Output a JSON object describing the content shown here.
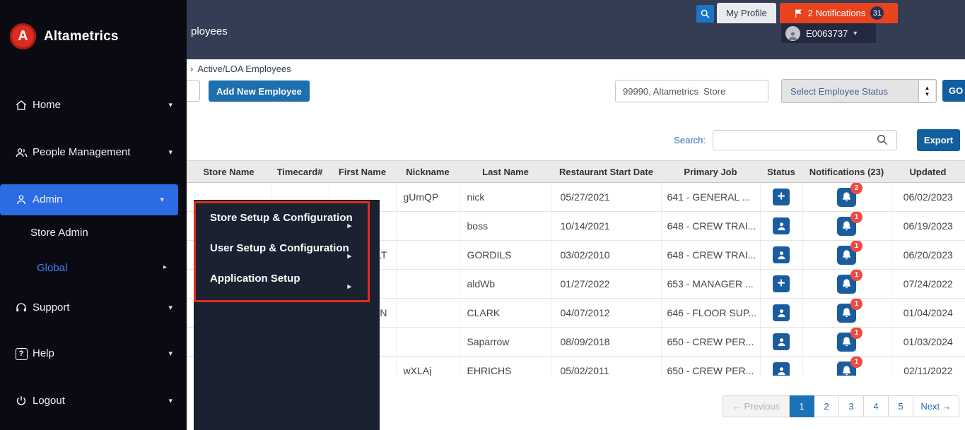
{
  "icons": {
    "chevron_down": "▾",
    "chevron_right": "▸",
    "breadcrumb_arrow": "›",
    "caret_down": "▾",
    "spinner_up": "▲",
    "spinner_down": "▼",
    "plus": "+",
    "help_mark": "?"
  },
  "colors": {
    "accent_blue": "#1b5c9e",
    "notification_red": "#e8431f",
    "annotation_red": "#e52b1e",
    "admin_highlight": "#2b6be4"
  },
  "sidebar": {
    "brand": "Altametrics",
    "brand_initial": "A",
    "items": [
      {
        "label": "Home"
      },
      {
        "label": "People Management"
      },
      {
        "label": "Admin"
      },
      {
        "label": "Store Admin"
      },
      {
        "label": "Global"
      },
      {
        "label": "Support"
      },
      {
        "label": "Help"
      },
      {
        "label": "Logout"
      }
    ]
  },
  "topbar": {
    "page_title_fragment": "ployees",
    "my_profile_label": "My Profile",
    "notifications_label": "2 Notifications",
    "notifications_badge": "31",
    "user_id": "E0063737"
  },
  "breadcrumb": {
    "label": "Active/LOA Employees"
  },
  "toolbar": {
    "add_employee_label": "Add New Employee",
    "store_value": "99990, Altametrics  Store",
    "employee_status_value": "Select Employee Status",
    "go_label": "GO"
  },
  "search_bar": {
    "label": "Search:",
    "value": "",
    "export_label": "Export"
  },
  "admin_flyout": {
    "items": [
      {
        "label": "Store Setup & Configuration"
      },
      {
        "label": "User Setup & Configuration"
      },
      {
        "label": "Application Setup"
      }
    ]
  },
  "table": {
    "headers": [
      "Store Name",
      "Timecard#",
      "First Name",
      "Nickname",
      "Last Name",
      "Restaurant Start Date",
      "Primary Job",
      "Status",
      "Notifications (23)",
      "Updated"
    ],
    "rows": [
      {
        "store_name": "",
        "timecard": "",
        "first_name": "",
        "nickname": "gUmQP",
        "last_name": "nick",
        "start_date": "05/27/2021",
        "primary_job": "641 - GENERAL ...",
        "status_icon": "plus",
        "notification_count": "2",
        "updated": "06/02/2023"
      },
      {
        "store_name": "",
        "timecard": "",
        "first_name": "",
        "nickname": "",
        "last_name": "boss",
        "start_date": "10/14/2021",
        "primary_job": "648 - CREW TRAI...",
        "status_icon": "person",
        "notification_count": "1",
        "updated": "06/19/2023"
      },
      {
        "store_name": "",
        "timecard": "",
        "first_name": "LT",
        "nickname": "",
        "last_name": "GORDILS",
        "start_date": "03/02/2010",
        "primary_job": "648 - CREW TRAI...",
        "status_icon": "person",
        "notification_count": "1",
        "updated": "06/20/2023"
      },
      {
        "store_name": "",
        "timecard": "",
        "first_name": "",
        "nickname": "",
        "last_name": "aldWb",
        "start_date": "01/27/2022",
        "primary_job": "653 - MANAGER ...",
        "status_icon": "plus",
        "notification_count": "1",
        "updated": "07/24/2022"
      },
      {
        "store_name": "",
        "timecard": "",
        "first_name": "N",
        "nickname": "",
        "last_name": "CLARK",
        "start_date": "04/07/2012",
        "primary_job": "646 - FLOOR SUP...",
        "status_icon": "person",
        "notification_count": "1",
        "updated": "01/04/2024"
      },
      {
        "store_name": "",
        "timecard": "",
        "first_name": "",
        "nickname": "",
        "last_name": "Saparrow",
        "start_date": "08/09/2018",
        "primary_job": "650 - CREW PER...",
        "status_icon": "person",
        "notification_count": "1",
        "updated": "01/03/2024"
      },
      {
        "store_name": "",
        "timecard": "",
        "first_name": "",
        "nickname": "wXLAj",
        "last_name": "EHRICHS",
        "start_date": "05/02/2011",
        "primary_job": "650 - CREW PER...",
        "status_icon": "person",
        "notification_count": "1",
        "updated": "02/11/2022"
      }
    ]
  },
  "pagination": {
    "previous_label": "← Previous",
    "pages": [
      "1",
      "2",
      "3",
      "4",
      "5"
    ],
    "active_page": "1",
    "next_label": "Next →"
  }
}
